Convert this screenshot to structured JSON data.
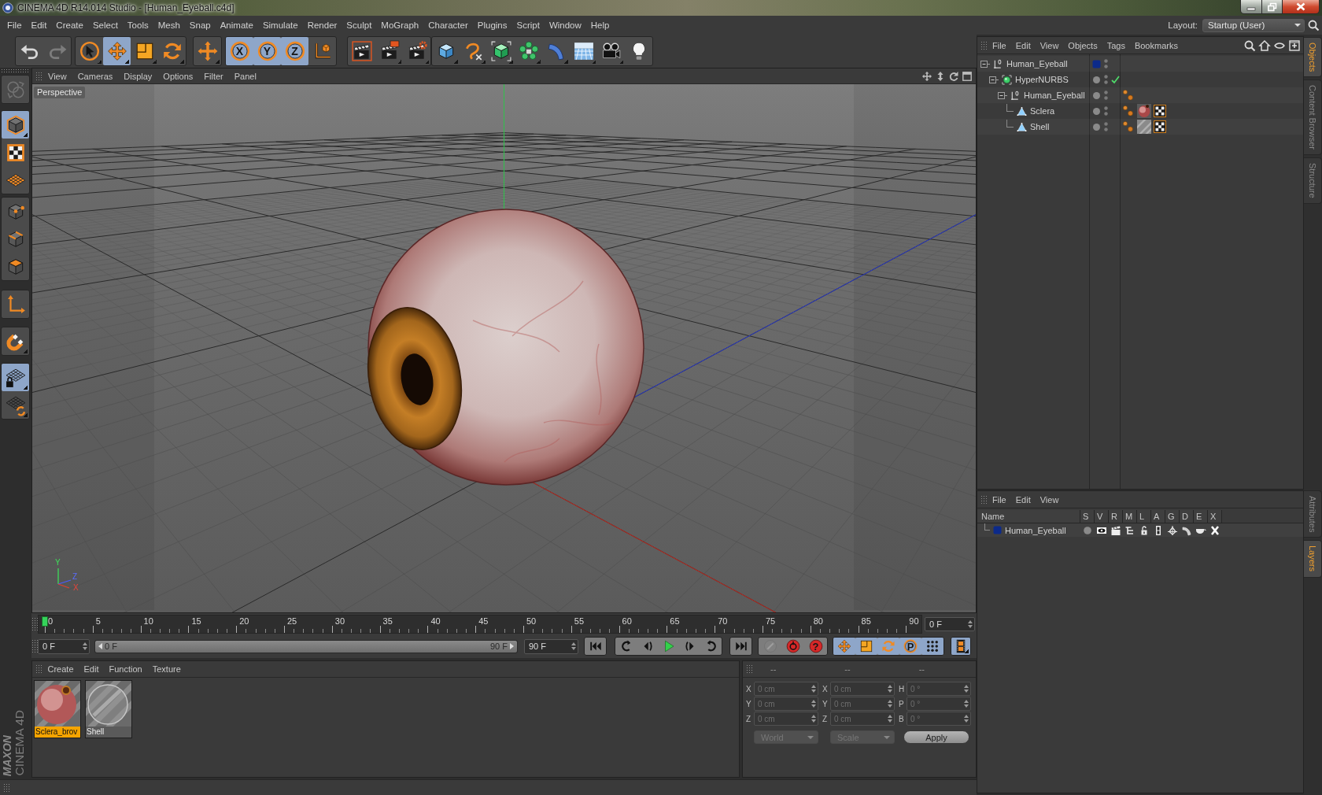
{
  "window": {
    "title": "CINEMA 4D R14.014 Studio - [Human_Eyeball.c4d]"
  },
  "menu_bar": {
    "items": [
      "File",
      "Edit",
      "Create",
      "Select",
      "Tools",
      "Mesh",
      "Snap",
      "Animate",
      "Simulate",
      "Render",
      "Sculpt",
      "MoGraph",
      "Character",
      "Plugins",
      "Script",
      "Window",
      "Help"
    ],
    "layout_label": "Layout:",
    "layout_value": "Startup (User)"
  },
  "toolbar": {
    "groups": [
      {
        "buttons": [
          {
            "kind": "undo",
            "selected": false,
            "disabled": false
          },
          {
            "kind": "redo",
            "selected": false,
            "disabled": true
          }
        ]
      },
      {
        "buttons": [
          {
            "kind": "live-selection",
            "selected": false,
            "disabled": false
          },
          {
            "kind": "move",
            "selected": true,
            "disabled": false
          },
          {
            "kind": "scale",
            "selected": false,
            "disabled": false
          },
          {
            "kind": "rotate",
            "selected": false,
            "disabled": false
          }
        ]
      },
      {
        "buttons": [
          {
            "kind": "recent-tool",
            "selected": false,
            "disabled": false
          }
        ]
      },
      {
        "buttons": [
          {
            "kind": "axis-lock",
            "label": "X",
            "selected": true,
            "disabled": false
          },
          {
            "kind": "axis-lock",
            "label": "Y",
            "selected": true,
            "disabled": false
          },
          {
            "kind": "axis-lock",
            "label": "Z",
            "selected": true,
            "disabled": false
          },
          {
            "kind": "coordinate-system",
            "selected": false,
            "disabled": false
          }
        ]
      },
      {
        "buttons": [
          {
            "kind": "render-view",
            "selected": false,
            "disabled": false
          },
          {
            "kind": "render-picture-viewer",
            "selected": false,
            "disabled": false
          },
          {
            "kind": "render-settings",
            "selected": false,
            "disabled": false
          }
        ]
      },
      {
        "buttons": [
          {
            "kind": "cube",
            "selected": false,
            "disabled": false
          },
          {
            "kind": "spline-pen",
            "selected": false,
            "disabled": false
          },
          {
            "kind": "subdivision",
            "selected": false,
            "disabled": false
          },
          {
            "kind": "cloner",
            "selected": false,
            "disabled": false
          },
          {
            "kind": "bend",
            "selected": false,
            "disabled": false
          },
          {
            "kind": "floor",
            "selected": false,
            "disabled": false
          },
          {
            "kind": "camera",
            "selected": false,
            "disabled": false
          },
          {
            "kind": "light",
            "selected": false,
            "disabled": false
          }
        ]
      }
    ]
  },
  "left_tools": {
    "groups": [
      {
        "buttons": [
          {
            "kind": "view-switch",
            "selected": false,
            "disabled": true
          }
        ]
      },
      {
        "buttons": [
          {
            "kind": "model-mode",
            "selected": true,
            "disabled": false
          },
          {
            "kind": "texture-mode",
            "selected": false,
            "disabled": false
          },
          {
            "kind": "workplane-mode",
            "selected": false,
            "disabled": false
          }
        ]
      },
      {
        "buttons": [
          {
            "kind": "points-mode",
            "selected": false,
            "disabled": false
          },
          {
            "kind": "edges-mode",
            "selected": false,
            "disabled": false
          },
          {
            "kind": "polygons-mode",
            "selected": false,
            "disabled": false
          }
        ]
      },
      {
        "buttons": [
          {
            "kind": "axis-mode",
            "selected": false,
            "disabled": false
          }
        ]
      },
      {
        "buttons": [
          {
            "kind": "snap",
            "selected": false,
            "disabled": false
          }
        ]
      },
      {
        "buttons": [
          {
            "kind": "workplane-lock",
            "selected": true,
            "disabled": false
          },
          {
            "kind": "planar-workplane",
            "selected": false,
            "disabled": false
          }
        ]
      }
    ]
  },
  "viewport": {
    "menu": [
      "View",
      "Cameras",
      "Display",
      "Options",
      "Filter",
      "Panel"
    ],
    "camera": "Perspective",
    "axis_labels": [
      "Y",
      "Z",
      "X"
    ]
  },
  "object_manager": {
    "menu": [
      "File",
      "Edit",
      "View",
      "Objects",
      "Tags",
      "Bookmarks"
    ],
    "objects": [
      {
        "name": "Human_Eyeball",
        "kind": "null",
        "color": "#0c2a8a",
        "check": false,
        "expanded": true,
        "children": [
          {
            "name": "HyperNURBS",
            "kind": "subdivision",
            "check": true,
            "expanded": true,
            "children": [
              {
                "name": "Human_Eyeball",
                "kind": "null",
                "check": false,
                "expanded": true,
                "tags": [
                  {
                    "kind": "phong"
                  }
                ],
                "children": [
                  {
                    "name": "Sclera",
                    "kind": "polygon",
                    "check": false,
                    "tags": [
                      {
                        "kind": "phong"
                      },
                      {
                        "kind": "sclera-material"
                      },
                      {
                        "kind": "uvw"
                      }
                    ]
                  },
                  {
                    "name": "Shell",
                    "kind": "polygon",
                    "check": false,
                    "tags": [
                      {
                        "kind": "phong"
                      },
                      {
                        "kind": "shell-material"
                      },
                      {
                        "kind": "uvw"
                      }
                    ]
                  }
                ]
              }
            ]
          }
        ]
      }
    ]
  },
  "side_tabs_top": [
    {
      "label": "Objects",
      "selected": true
    },
    {
      "label": "Content Browser",
      "selected": false
    },
    {
      "label": "Structure",
      "selected": false
    }
  ],
  "layer_manager": {
    "menu": [
      "File",
      "Edit",
      "View"
    ],
    "columns": [
      "Name",
      "S",
      "V",
      "R",
      "M",
      "L",
      "A",
      "G",
      "D",
      "E",
      "X"
    ],
    "layers": [
      {
        "name": "Human_Eyeball",
        "color": "#0c2a8a",
        "switches": [
          {
            "kind": "solo",
            "on": false
          },
          {
            "kind": "view",
            "on": true
          },
          {
            "kind": "render",
            "on": true
          },
          {
            "kind": "manager",
            "on": true
          },
          {
            "kind": "locked",
            "on": false
          },
          {
            "kind": "animation",
            "on": true
          },
          {
            "kind": "generators",
            "on": true
          },
          {
            "kind": "deformers",
            "on": true
          },
          {
            "kind": "expressions",
            "on": true
          },
          {
            "kind": "xref",
            "on": true
          }
        ]
      }
    ]
  },
  "side_tabs_bottom": [
    {
      "label": "Attributes",
      "selected": false
    },
    {
      "label": "Layers",
      "selected": true
    }
  ],
  "timeline": {
    "ticks": [
      "0",
      "5",
      "10",
      "15",
      "20",
      "25",
      "30",
      "35",
      "40",
      "45",
      "50",
      "55",
      "60",
      "65",
      "70",
      "75",
      "80",
      "85",
      "90"
    ],
    "level": 0,
    "frame_field": "0 F"
  },
  "transport": {
    "start_field": "0 F",
    "range_slider": {
      "start": "0 F",
      "end": "90 F",
      "level": 1
    },
    "end_field": "90 F",
    "groups": [
      {
        "buttons": [
          {
            "kind": "go-start",
            "selected": false,
            "disabled": false
          }
        ]
      },
      {
        "buttons": [
          {
            "kind": "previous-key",
            "selected": false,
            "disabled": false
          },
          {
            "kind": "previous-frame",
            "selected": false,
            "disabled": false
          },
          {
            "kind": "play",
            "selected": false,
            "disabled": false
          },
          {
            "kind": "next-frame",
            "selected": false,
            "disabled": false
          },
          {
            "kind": "next-key",
            "selected": false,
            "disabled": false
          }
        ]
      },
      {
        "buttons": [
          {
            "kind": "go-end",
            "selected": false,
            "disabled": false
          }
        ]
      },
      {
        "buttons": [
          {
            "kind": "autokey",
            "selected": false,
            "disabled": true
          },
          {
            "kind": "record",
            "selected": false,
            "disabled": false
          },
          {
            "kind": "key-selection",
            "label": "?",
            "selected": false,
            "disabled": false
          }
        ]
      },
      {
        "buttons": [
          {
            "kind": "key-position",
            "selected": true,
            "disabled": false
          },
          {
            "kind": "key-scale",
            "selected": true,
            "disabled": false
          },
          {
            "kind": "key-rotation",
            "selected": true,
            "disabled": false
          },
          {
            "kind": "key-parameter",
            "label": "P",
            "selected": true,
            "disabled": false
          },
          {
            "kind": "key-pla",
            "selected": true,
            "disabled": false
          }
        ]
      },
      {
        "buttons": [
          {
            "kind": "timeline-window",
            "selected": true,
            "disabled": false
          }
        ]
      }
    ]
  },
  "material_manager": {
    "menu": [
      "Create",
      "Edit",
      "Function",
      "Texture"
    ],
    "materials": [
      {
        "name": "Sclera_brov",
        "kind": "sclera",
        "selected": true
      },
      {
        "name": "Shell",
        "kind": "shell",
        "selected": false
      }
    ]
  },
  "coordinates": {
    "headers": [
      "--",
      "--",
      "--"
    ],
    "rows": [
      [
        {
          "axis": "X",
          "value": "0 cm"
        },
        {
          "axis": "X",
          "value": "0 cm"
        },
        {
          "axis": "H",
          "value": "0 °"
        }
      ],
      [
        {
          "axis": "Y",
          "value": "0 cm"
        },
        {
          "axis": "Y",
          "value": "0 cm"
        },
        {
          "axis": "P",
          "value": "0 °"
        }
      ],
      [
        {
          "axis": "Z",
          "value": "0 cm"
        },
        {
          "axis": "Z",
          "value": "0 cm"
        },
        {
          "axis": "B",
          "value": "0 °"
        }
      ]
    ],
    "disabled": true,
    "dropdowns": [
      "World",
      "Scale"
    ],
    "apply": "Apply"
  },
  "logo": {
    "brand": "MAXON",
    "product": "CINEMA 4D"
  }
}
